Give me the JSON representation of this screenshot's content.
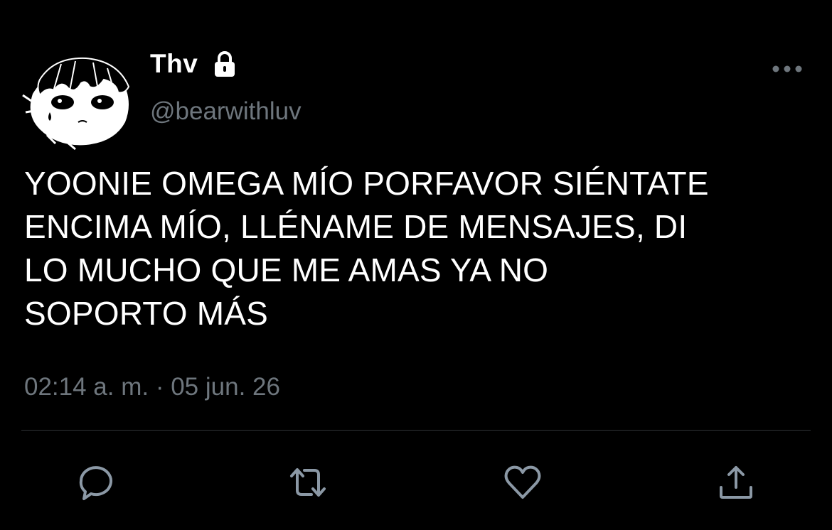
{
  "tweet": {
    "display_name": "Thv",
    "handle": "@bearwithluv",
    "text": "YOONIE OMEGA MÍO PORFAVOR SIÉNTATE\nENCIMA MÍO, LLÉNAME DE MENSAJES, DI\nLO MUCHO QUE ME AMAS YA NO\nSOPORTO MÁS",
    "timestamp": "02:14 a. m. · 05 jun. 26",
    "account_protected": true
  },
  "icons": {
    "lock": "lock-icon",
    "more": "more-options-icon",
    "reply": "reply-icon",
    "retweet": "retweet-icon",
    "like": "heart-icon",
    "share": "share-icon"
  },
  "colors": {
    "background": "#000000",
    "text_primary": "#ffffff",
    "text_secondary": "#6e767d",
    "divider": "#2f3336"
  }
}
